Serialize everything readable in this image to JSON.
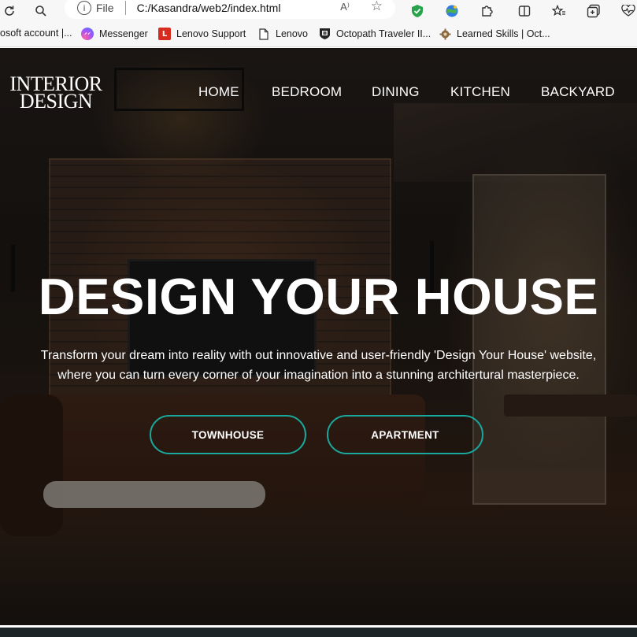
{
  "browser": {
    "toolbar": {
      "refresh_icon": "refresh-icon",
      "search_icon": "search-icon",
      "address": {
        "scheme": "File",
        "url": "C:/Kasandra/web2/index.html",
        "read_aloud": "A⁾"
      },
      "extensions": [
        "shield-extension-icon",
        "globe-extension-icon",
        "puzzle-extensions-icon",
        "split-screen-icon",
        "favorites-icon",
        "collections-icon",
        "heart-monitor-icon"
      ]
    },
    "bookmarks": [
      {
        "label": "osoft account |...",
        "icon": "none"
      },
      {
        "label": "Messenger",
        "icon": "messenger-icon"
      },
      {
        "label": "Lenovo Support",
        "icon": "lenovo-icon",
        "glyph": "L"
      },
      {
        "label": "Lenovo",
        "icon": "page-icon"
      },
      {
        "label": "Octopath Traveler II...",
        "icon": "crest-icon"
      },
      {
        "label": "Learned Skills | Oct...",
        "icon": "gear-favicon-icon"
      }
    ]
  },
  "page": {
    "logo": {
      "line1": "INTERIOR",
      "line2": "DESIGN"
    },
    "nav": [
      "HOME",
      "BEDROOM",
      "DINING",
      "KITCHEN",
      "BACKYARD"
    ],
    "headline": "DESIGN YOUR HOUSE",
    "subtext_line1": "Transform your dream into reality with out innovative and user-friendly 'Design Your House' website,",
    "subtext_line2": "where you can turn every corner of your imagination into a stunning architertural masterpiece.",
    "buttons": {
      "townhouse": "TOWNHOUSE",
      "apartment": "APARTMENT"
    },
    "accent_color": "#1aa89d"
  }
}
